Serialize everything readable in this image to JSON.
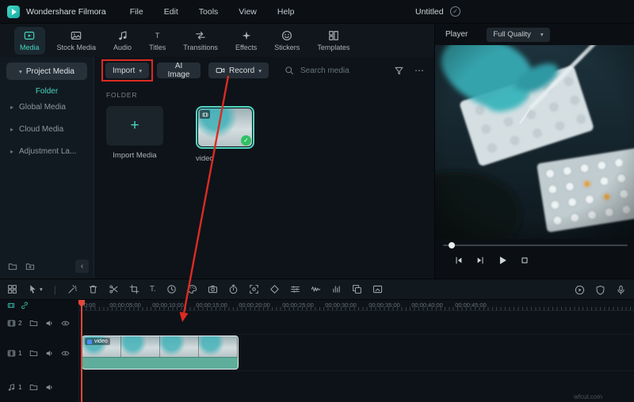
{
  "menu": {
    "app_name": "Wondershare Filmora",
    "items": [
      "File",
      "Edit",
      "Tools",
      "View",
      "Help"
    ],
    "project_name": "Untitled"
  },
  "tabs": [
    "Media",
    "Stock Media",
    "Audio",
    "Titles",
    "Transitions",
    "Effects",
    "Stickers",
    "Templates"
  ],
  "sidebar": {
    "project_media": "Project Media",
    "folder": "Folder",
    "items": [
      "Global Media",
      "Cloud Media",
      "Adjustment La..."
    ]
  },
  "media_toolbar": {
    "import": "Import",
    "ai_image": "AI Image",
    "record": "Record",
    "search_placeholder": "Search media"
  },
  "media_panel": {
    "section": "FOLDER",
    "import_tile": "Import Media",
    "video_tile": "video"
  },
  "player": {
    "label": "Player",
    "quality": "Full Quality"
  },
  "timeline": {
    "ruler": [
      "0:00",
      "00:00:05:00",
      "00:00:10:00",
      "00:00:15:00",
      "00:00:20:00",
      "00:00:25:00",
      "00:00:30:00",
      "00:00:35:00",
      "00:00:40:00",
      "00:00:45:00"
    ],
    "clip_label": "video",
    "track_video2": "2",
    "track_video1": "1",
    "track_audio1": "1"
  },
  "watermark": "wfcut.com",
  "colors": {
    "accent_teal": "#45d6c1",
    "annotation_red": "#dc2b22",
    "clip_teal": "#5fae9c",
    "check_green": "#2fc163"
  },
  "icons": {
    "caret_down": "▾",
    "chevron_right": "▸",
    "collapse": "‹",
    "more": "⋯",
    "plus": "+",
    "check": "✓",
    "divider": "|",
    "titles_glyph": "T",
    "text_tool": "T."
  }
}
